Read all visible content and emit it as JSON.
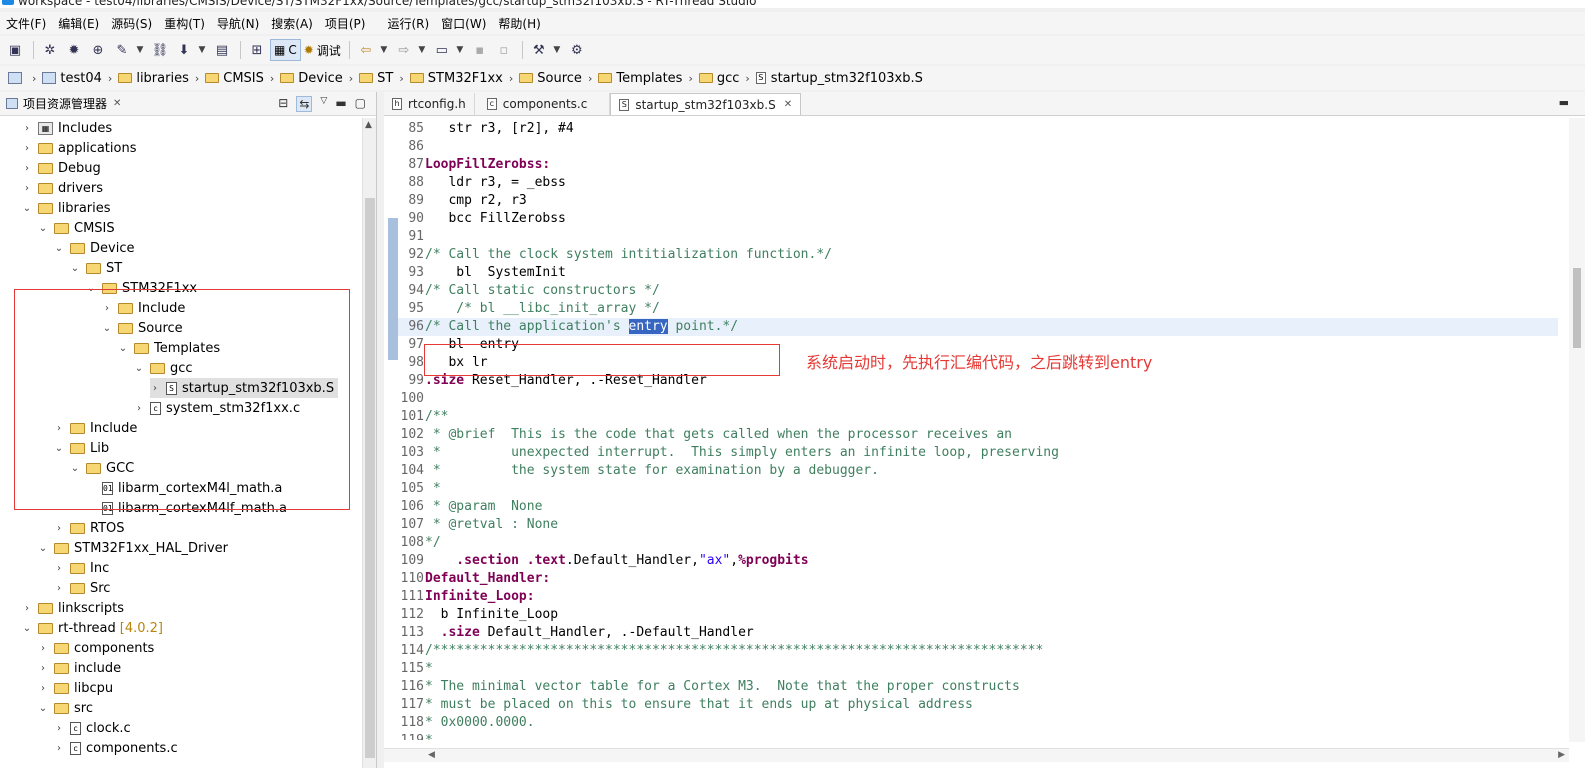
{
  "window": {
    "title": "workspace - test04/libraries/CMSIS/Device/ST/STM32F1xx/Source/Templates/gcc/startup_stm32f103xb.S - RT-Thread Studio"
  },
  "menu": [
    "文件(F)",
    "编辑(E)",
    "源码(S)",
    "重构(T)",
    "导航(N)",
    "搜索(A)",
    "项目(P)",
    "运行(R)",
    "窗口(W)",
    "帮助(H)"
  ],
  "toolbar": {
    "c_label": "C",
    "debug_label": "调试"
  },
  "breadcrumb": [
    "test04",
    "libraries",
    "CMSIS",
    "Device",
    "ST",
    "STM32F1xx",
    "Source",
    "Templates",
    "gcc",
    "startup_stm32f103xb.S"
  ],
  "project_explorer": {
    "title": "项目资源管理器",
    "close": "✕",
    "items": [
      {
        "label": "Includes"
      },
      {
        "label": "applications"
      },
      {
        "label": "Debug"
      },
      {
        "label": "drivers"
      },
      {
        "label": "libraries"
      },
      {
        "label": "CMSIS"
      },
      {
        "label": "Device"
      },
      {
        "label": "ST"
      },
      {
        "label": "STM32F1xx"
      },
      {
        "label": "Include"
      },
      {
        "label": "Source"
      },
      {
        "label": "Templates"
      },
      {
        "label": "gcc"
      },
      {
        "label": "startup_stm32f103xb.S"
      },
      {
        "label": "system_stm32f1xx.c"
      },
      {
        "label": "Include"
      },
      {
        "label": "Lib"
      },
      {
        "label": "GCC"
      },
      {
        "label": "libarm_cortexM4l_math.a"
      },
      {
        "label": "libarm_cortexM4lf_math.a"
      },
      {
        "label": "RTOS"
      },
      {
        "label": "STM32F1xx_HAL_Driver"
      },
      {
        "label": "Inc"
      },
      {
        "label": "Src"
      },
      {
        "label": "linkscripts"
      },
      {
        "label": "rt-thread",
        "version": "[4.0.2]"
      },
      {
        "label": "components"
      },
      {
        "label": "include"
      },
      {
        "label": "libcpu"
      },
      {
        "label": "src"
      },
      {
        "label": "clock.c"
      },
      {
        "label": "components.c"
      }
    ]
  },
  "editor": {
    "tabs": [
      {
        "label": "rtconfig.h",
        "icon": "h"
      },
      {
        "label": "components.c",
        "icon": "c"
      },
      {
        "label": "startup_stm32f103xb.S",
        "icon": "S"
      }
    ],
    "lines": [
      {
        "n": "85",
        "t": "  str r3, [r2], #4"
      },
      {
        "n": "86",
        "t": ""
      },
      {
        "n": "87",
        "t": "LoopFillZerobss:"
      },
      {
        "n": "88",
        "t": "  ldr r3, = _ebss"
      },
      {
        "n": "89",
        "t": "  cmp r2, r3"
      },
      {
        "n": "90",
        "t": "  bcc FillZerobss"
      },
      {
        "n": "91",
        "t": ""
      },
      {
        "n": "92",
        "t": "/* Call the clock system intitialization function.*/"
      },
      {
        "n": "93",
        "t": "    bl  SystemInit"
      },
      {
        "n": "94",
        "t": "/* Call static constructors */"
      },
      {
        "n": "95",
        "t": "    /* bl __libc_init_array */"
      },
      {
        "n": "96a",
        "t": "/* Call the application's "
      },
      {
        "n": "96b",
        "t": "entry"
      },
      {
        "n": "96c",
        "t": " point.*/"
      },
      {
        "n": "97",
        "t": "  bl  entry"
      },
      {
        "n": "98",
        "t": "  bx lr"
      },
      {
        "n": "99a",
        "t": ".size"
      },
      {
        "n": "99b",
        "t": " Reset_Handler, .-Reset_Handler"
      },
      {
        "n": "100",
        "t": ""
      },
      {
        "n": "101",
        "t": "/**"
      },
      {
        "n": "102",
        "t": " * @brief  This is the code that gets called when the processor receives an"
      },
      {
        "n": "103",
        "t": " *         unexpected interrupt.  This simply enters an infinite loop, preserving"
      },
      {
        "n": "104",
        "t": " *         the system state for examination by a debugger."
      },
      {
        "n": "105",
        "t": " *"
      },
      {
        "n": "106",
        "t": " * @param  None"
      },
      {
        "n": "107",
        "t": " * @retval : None"
      },
      {
        "n": "108",
        "t": "*/"
      },
      {
        "n": "109a",
        "t": "    .section"
      },
      {
        "n": "109b",
        "t": " "
      },
      {
        "n": "109c",
        "t": ".text"
      },
      {
        "n": "109d",
        "t": ".Default_Handler,"
      },
      {
        "n": "109e",
        "t": "\"ax\""
      },
      {
        "n": "109f",
        "t": ","
      },
      {
        "n": "109g",
        "t": "%progbits"
      },
      {
        "n": "110",
        "t": "Default_Handler:"
      },
      {
        "n": "111",
        "t": "Infinite_Loop:"
      },
      {
        "n": "112",
        "t": "  b Infinite_Loop"
      },
      {
        "n": "113a",
        "t": "  .size"
      },
      {
        "n": "113b",
        "t": " Default_Handler, .-Default_Handler"
      },
      {
        "n": "114",
        "t": "/******************************************************************************"
      },
      {
        "n": "115",
        "t": "*"
      },
      {
        "n": "116",
        "t": "* The minimal vector table for a Cortex M3.  Note that the proper constructs"
      },
      {
        "n": "117",
        "t": "* must be placed on this to ensure that it ends up at physical address"
      },
      {
        "n": "118",
        "t": "* 0x0000.0000."
      },
      {
        "n": "119",
        "t": "*"
      }
    ]
  },
  "annotation": "系统启动时，先执行汇编代码，之后跳转到entry",
  "colors": {
    "keyword": "#7f0055",
    "comment": "#3f7f5f",
    "string": "#2a00ff",
    "annotation": "#e53935"
  }
}
